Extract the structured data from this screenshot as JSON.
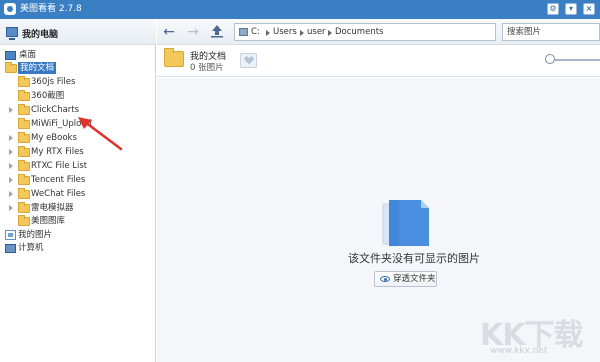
{
  "app": {
    "title": "美图看看 2.7.8"
  },
  "window_controls": {
    "settings": "⚙",
    "menu": "▾",
    "close": "×"
  },
  "sidebar": {
    "title": "我的电脑",
    "items": [
      {
        "label": "桌面",
        "icon": "desktop-icon"
      },
      {
        "label": "我的文档",
        "icon": "folder-icon",
        "selected": true
      },
      {
        "label": "360js Files",
        "icon": "folder-icon"
      },
      {
        "label": "360截图",
        "icon": "folder-icon"
      },
      {
        "label": "ClickCharts",
        "icon": "folder-icon"
      },
      {
        "label": "MiWiFi_Upload",
        "icon": "folder-icon"
      },
      {
        "label": "My eBooks",
        "icon": "folder-icon"
      },
      {
        "label": "My RTX Files",
        "icon": "folder-icon"
      },
      {
        "label": "RTXC File List",
        "icon": "folder-icon"
      },
      {
        "label": "Tencent Files",
        "icon": "folder-icon"
      },
      {
        "label": "WeChat Files",
        "icon": "folder-icon"
      },
      {
        "label": "雷电模拟器",
        "icon": "folder-icon"
      },
      {
        "label": "美图图库",
        "icon": "folder-icon"
      },
      {
        "label": "我的图片",
        "icon": "pictures-icon"
      },
      {
        "label": "计算机",
        "icon": "computer-icon"
      }
    ]
  },
  "toolbar": {
    "back": "←",
    "forward": "→",
    "up": "⇧",
    "breadcrumbs": [
      "C:",
      "Users",
      "user",
      "Documents"
    ],
    "search_placeholder": "搜索图片"
  },
  "folder_info": {
    "name": "我的文档",
    "count": "0 张图片",
    "favorite_icon": "heart-icon"
  },
  "empty_state": {
    "message": "该文件夹没有可显示的图片",
    "button_label": "穿透文件夹"
  },
  "watermark": {
    "logo": "KK下载",
    "url": "www.kkx.net"
  },
  "colors": {
    "titlebar": "#3a7fc4",
    "selection": "#3779c3",
    "folder": "#f3c85a",
    "annotation_arrow": "#e0322b"
  }
}
